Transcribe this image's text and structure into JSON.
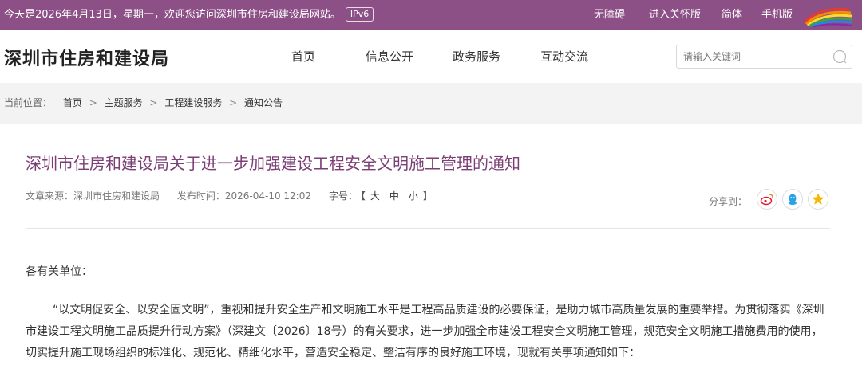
{
  "topbar": {
    "welcome": "今天是2026年4月13日，星期一，欢迎您访问深圳市住房和建设局网站。",
    "ipv6": "IPv6",
    "links": {
      "accessibility": "无障碍",
      "elderly": "进入关怀版",
      "simplified": "简体",
      "mobile": "手机版"
    },
    "colors": {
      "background": "#8c4f86"
    }
  },
  "header": {
    "site_title": "深圳市住房和建设局",
    "nav": [
      "首页",
      "信息公开",
      "政务服务",
      "互动交流"
    ],
    "search": {
      "placeholder": "请输入关键词",
      "icon": "search-icon"
    }
  },
  "breadcrumb": {
    "label": "当前位置：",
    "items": [
      "首页",
      "主题服务",
      "工程建设服务",
      "通知公告"
    ],
    "separator": ">"
  },
  "article": {
    "title": "深圳市住房和建设局关于进一步加强建设工程安全文明施工管理的通知",
    "source": "文章来源：深圳市住房和建设局",
    "published": "发布时间：2026-04-10 12:02",
    "font_size_label": "字号：",
    "font_size_open": "【",
    "font_sizes": [
      "大",
      "中",
      "小"
    ],
    "font_size_close": "】",
    "share_label": "分享到：",
    "share_icons": [
      "weibo-icon",
      "qq-icon",
      "qzone-icon"
    ],
    "salutation": "各有关单位：",
    "paragraph": "“以文明促安全、以安全固文明”，重视和提升安全生产和文明施工水平是工程高品质建设的必要保证，是助力城市高质量发展的重要举措。为贯彻落实《深圳市建设工程文明施工品质提升行动方案》（深建文〔2026〕18号）的有关要求，进一步加强全市建设工程安全文明施工管理，规范安全文明施工措施费用的使用，切实提升施工现场组织的标准化、规范化、精细化水平，营造安全稳定、整洁有序的良好施工环境，现就有关事项通知如下："
  },
  "colors": {
    "title": "#7b3e75",
    "weibo": "#e6162d",
    "qq": "#2aa3e6",
    "qzone": "#f5b70a"
  }
}
